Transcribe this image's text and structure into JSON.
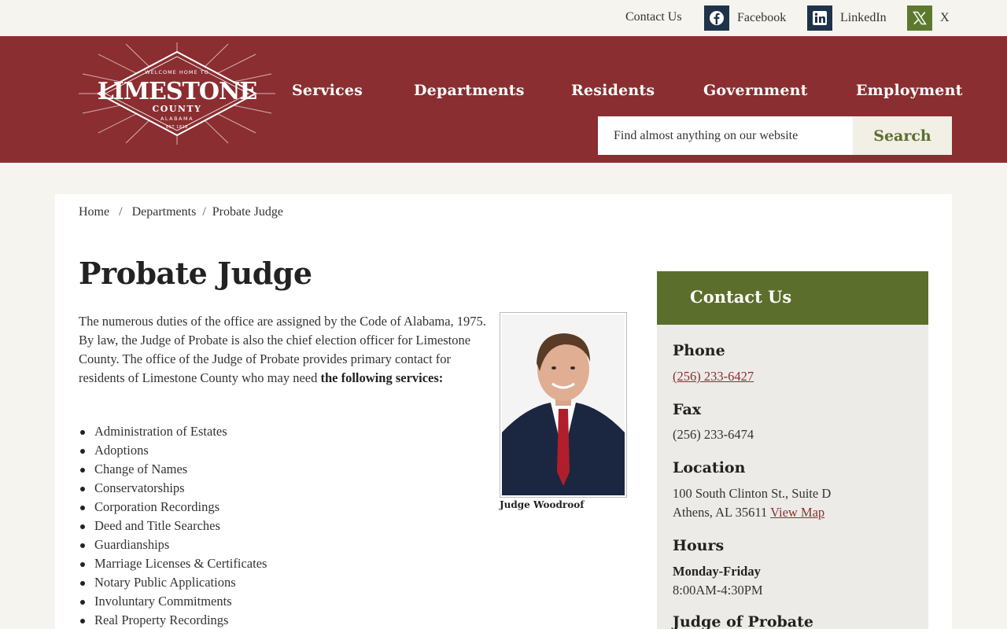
{
  "topbar": {
    "contact": "Contact Us",
    "facebook": "Facebook",
    "linkedin": "LinkedIn",
    "x": "X"
  },
  "logo": {
    "top": "WELCOME HOME TO",
    "name": "LIMESTONE",
    "county": "COUNTY",
    "state": "ALABAMA",
    "est": "EST 1818"
  },
  "nav": {
    "items": [
      "Services",
      "Departments",
      "Residents",
      "Government",
      "Employment"
    ]
  },
  "search": {
    "placeholder": "Find almost anything on our website",
    "button": "Search"
  },
  "breadcrumb": {
    "home": "Home",
    "departments": "Departments",
    "current": "Probate Judge",
    "separator": "/"
  },
  "main": {
    "title": "Probate Judge",
    "intro": "The numerous duties of the office are assigned by the Code of Alabama, 1975. By law, the Judge of Probate is also the chief election officer for Limestone County. The office of the Judge of Probate provides primary contact for residents of Limestone County who may need",
    "intro_bold": "the following services:",
    "services": [
      "Administration of Estates",
      "Adoptions",
      "Change of Names",
      "Conservatorships",
      "Corporation Recordings",
      "Deed and Title Searches",
      "Guardianships",
      "Marriage Licenses & Certificates",
      "Notary Public Applications",
      "Involuntary Commitments",
      "Real Property Recordings"
    ],
    "photo_caption": "Judge Woodroof"
  },
  "sidebar": {
    "title": "Contact Us",
    "phone_label": "Phone",
    "phone": "(256) 233-6427",
    "fax_label": "Fax",
    "fax": "(256) 233-6474",
    "location_label": "Location",
    "address1": "100 South Clinton St., Suite D",
    "address2": "Athens, AL 35611",
    "map_link": "View Map",
    "hours_label": "Hours",
    "hours_days": "Monday-Friday",
    "hours_time": "8:00AM-4:30PM",
    "judge_label": "Judge of Probate"
  },
  "colors": {
    "header": "#8b2e31",
    "accent_green": "#5c6e2c",
    "social_navy": "#1d3349",
    "background": "#f5f4ef"
  }
}
